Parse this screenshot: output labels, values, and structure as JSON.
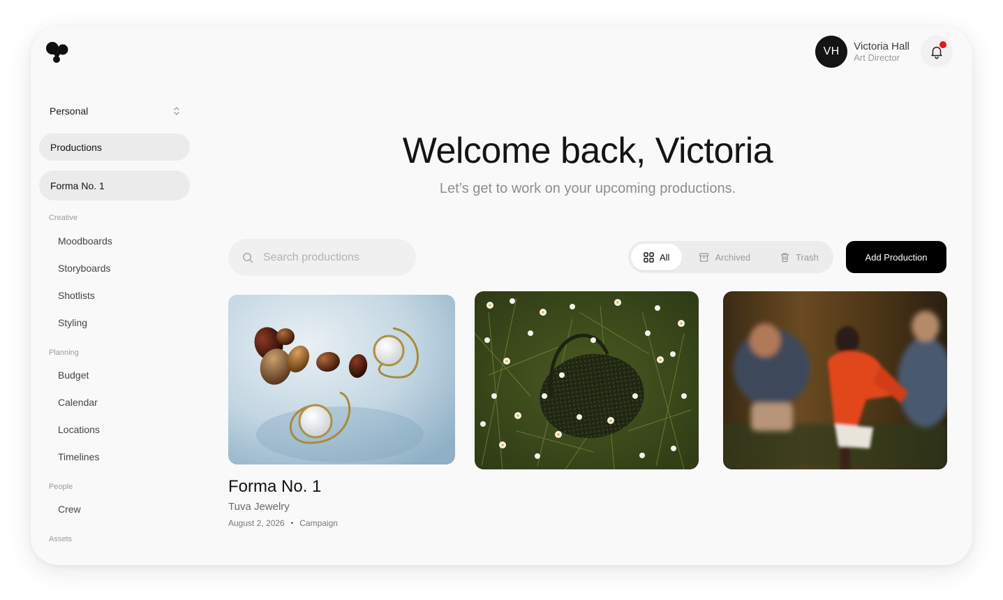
{
  "user": {
    "initials": "VH",
    "name": "Victoria Hall",
    "role": "Art Director",
    "notification_dot_color": "#e8161e"
  },
  "sidebar": {
    "workspace": "Personal",
    "primary": "Productions",
    "current_production": "Forma No. 1",
    "sections": [
      {
        "label": "Creative",
        "items": [
          "Moodboards",
          "Storyboards",
          "Shotlists",
          "Styling"
        ]
      },
      {
        "label": "Planning",
        "items": [
          "Budget",
          "Calendar",
          "Locations",
          "Timelines"
        ]
      },
      {
        "label": "People",
        "items": [
          "Crew"
        ]
      },
      {
        "label": "Assets",
        "items": []
      }
    ]
  },
  "hero": {
    "title": "Welcome back, Victoria",
    "subtitle": "Let’s get to work on your upcoming productions."
  },
  "search": {
    "placeholder": "Search productions"
  },
  "filters": [
    {
      "label": "All",
      "icon": "grid-icon",
      "active": true
    },
    {
      "label": "Archived",
      "icon": "archive-icon",
      "active": false
    },
    {
      "label": "Trash",
      "icon": "trash-icon",
      "active": false
    }
  ],
  "add_button": "Add Production",
  "productions": [
    {
      "title": "Forma No. 1",
      "client": "Tuva Jewelry",
      "date": "August 2, 2026",
      "type": "Campaign",
      "image": "jewelry-stones-photo"
    },
    {
      "image": "daisy-field-photo"
    },
    {
      "image": "runners-motion-photo"
    }
  ],
  "colors": {
    "accent": "#000000",
    "surface": "#f9f9f9",
    "pill": "#ebebeb"
  }
}
